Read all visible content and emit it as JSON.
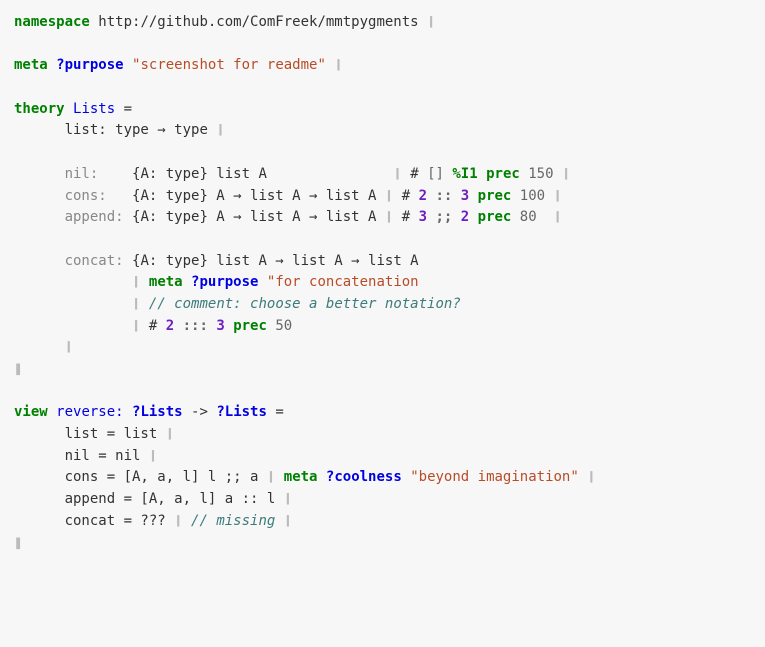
{
  "ns": {
    "kw": "namespace",
    "url": "http://github.com/ComFreek/mmtpygments"
  },
  "meta1": {
    "kw": "meta",
    "ref": "?purpose",
    "val": "\"screenshot for readme\""
  },
  "theory": {
    "kw": "theory",
    "name": "Lists",
    "eq": "=",
    "list_decl": "list: type → type",
    "nil": {
      "lhs_kw": "nil:",
      "lhs_pad": "   ",
      "body": " {A: type} list A              ",
      "hash": "#",
      "sym": " [] ",
      "pct": "%I1",
      "prec_kw": " prec",
      "prec": " 150"
    },
    "cons": {
      "lhs_kw": "cons:",
      "lhs_pad": "  ",
      "body": " {A: type} A → list A → list A",
      "hash": " #",
      "n1": " 2",
      "op": " ::",
      "n2": " 3",
      "prec_kw": " prec",
      "prec": " 100"
    },
    "append": {
      "lhs_kw": "append:",
      "body": " {A: type} A → list A → list A",
      "hash": " #",
      "n1": " 3",
      "op": " ;;",
      "n2": " 2",
      "prec_kw": " prec",
      "prec": " 80 "
    },
    "concat": {
      "lhs_kw": "concat:",
      "body": " {A: type} list A → list A → list A",
      "meta_kw": "meta",
      "meta_ref": " ?purpose",
      "meta_val": " \"for concatenation",
      "comment": "// comment: choose a better notation?",
      "hash": "#",
      "n1": " 2",
      "op": " :::",
      "n2": " 3",
      "prec_kw": " prec",
      "prec": " 50"
    }
  },
  "view": {
    "kw": "view",
    "name": "reverse:",
    "dom": " ?Lists",
    "arr": " ->",
    "cod": " ?Lists",
    "eq": " =",
    "list": "list = list",
    "nil": "nil = nil",
    "cons_l": "cons = [A, a, l] l ;; a",
    "cons_meta_kw": "meta",
    "cons_meta_ref": " ?coolness",
    "cons_meta_val": " \"beyond imagination\"",
    "append": "append = [A, a, l] a :: l",
    "concat_l": "concat = ??? ",
    "concat_cmt": "// missing"
  },
  "bar": "❙",
  "dbar": "❚"
}
